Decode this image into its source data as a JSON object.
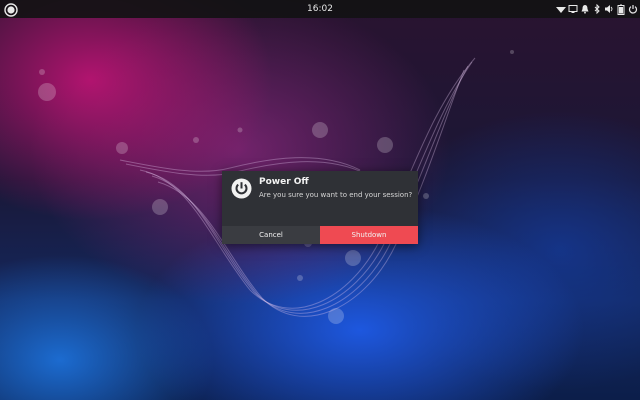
{
  "topbar": {
    "activities_icon": "ubuntu-circle-icon",
    "clock": "16:02",
    "tray_icons": [
      "wifi-icon",
      "display-icon",
      "notification-bell-icon",
      "bluetooth-icon",
      "volume-icon",
      "battery-icon",
      "power-icon"
    ]
  },
  "dialog": {
    "icon": "power-icon",
    "title": "Power Off",
    "message": "Are you sure you want to end your session?",
    "cancel_label": "Cancel",
    "shutdown_label": "Shutdown",
    "accent_color": "#ef4a52",
    "background_color": "#2f3136"
  }
}
